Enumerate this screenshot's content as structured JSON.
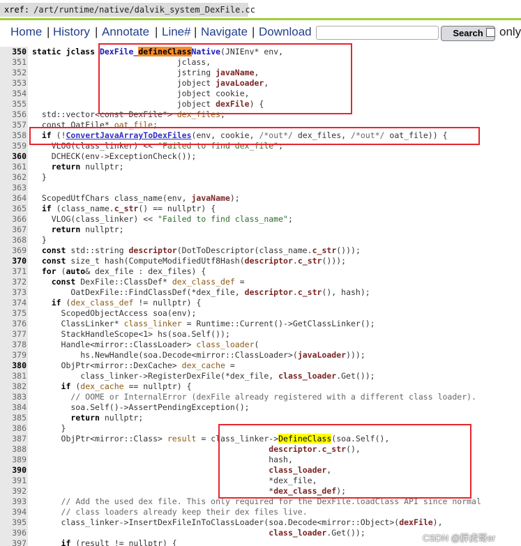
{
  "xref": {
    "label": "xref:",
    "path": "/art/runtime/native/dalvik_system_DexFile.cc"
  },
  "nav": {
    "items": [
      "Home",
      "History",
      "Annotate",
      "Line#",
      "Navigate",
      "Download"
    ],
    "separator": "|",
    "search_button": "Search",
    "only_label": "only"
  },
  "code": [
    {
      "n": "350",
      "b": true,
      "t": [
        [
          "static jclass ",
          "k"
        ],
        [
          "DexFile_",
          "fd"
        ],
        [
          "defineClass",
          "hl"
        ],
        [
          "Native",
          "fd"
        ],
        [
          "(JNIEnv* ",
          ""
        ],
        [
          "env",
          ""
        ],
        [
          ",",
          ""
        ]
      ]
    },
    {
      "n": "351",
      "t": [
        [
          "                              jclass,",
          ""
        ]
      ]
    },
    {
      "n": "352",
      "t": [
        [
          "                              jstring ",
          ""
        ],
        [
          "javaName",
          "v"
        ],
        [
          ",",
          ""
        ]
      ]
    },
    {
      "n": "353",
      "t": [
        [
          "                              jobject ",
          ""
        ],
        [
          "javaLoader",
          "v"
        ],
        [
          ",",
          ""
        ]
      ]
    },
    {
      "n": "354",
      "t": [
        [
          "                              jobject cookie,",
          ""
        ]
      ]
    },
    {
      "n": "355",
      "t": [
        [
          "                              jobject ",
          ""
        ],
        [
          "dexFile",
          "v"
        ],
        [
          ") {",
          ""
        ]
      ]
    },
    {
      "n": "356",
      "t": [
        [
          "  std::vector<const DexFile*> ",
          ""
        ],
        [
          "dex_files",
          "f"
        ],
        [
          ";",
          ""
        ]
      ]
    },
    {
      "n": "357",
      "t": [
        [
          "  const OatFile* ",
          ""
        ],
        [
          "oat_file",
          "f"
        ],
        [
          ";",
          ""
        ]
      ]
    },
    {
      "n": "358",
      "t": [
        [
          "  ",
          ""
        ],
        [
          "if",
          "k"
        ],
        [
          " (!",
          ""
        ],
        [
          "ConvertJavaArrayToDexFiles",
          "fx"
        ],
        [
          "(env, cookie, ",
          ""
        ],
        [
          "/*out*/",
          "c"
        ],
        [
          " dex_files, ",
          ""
        ],
        [
          "/*out*/",
          "c"
        ],
        [
          " oat_file)) {",
          ""
        ]
      ]
    },
    {
      "n": "359",
      "t": [
        [
          "    VLOG(class_linker) << ",
          ""
        ],
        [
          "\"Failed to find dex_file\"",
          "s"
        ],
        [
          ";",
          ""
        ]
      ]
    },
    {
      "n": "360",
      "b": true,
      "t": [
        [
          "    DCHECK(env->ExceptionCheck());",
          ""
        ]
      ]
    },
    {
      "n": "361",
      "t": [
        [
          "    ",
          ""
        ],
        [
          "return",
          "k"
        ],
        [
          " nullptr;",
          ""
        ]
      ]
    },
    {
      "n": "362",
      "t": [
        [
          "  }",
          ""
        ]
      ]
    },
    {
      "n": "363",
      "t": [
        [
          "",
          ""
        ]
      ]
    },
    {
      "n": "364",
      "t": [
        [
          "  ScopedUtfChars class_name(env, ",
          ""
        ],
        [
          "javaName",
          "v"
        ],
        [
          ");",
          ""
        ]
      ]
    },
    {
      "n": "365",
      "t": [
        [
          "  ",
          ""
        ],
        [
          "if",
          "k"
        ],
        [
          " (class_name.",
          ""
        ],
        [
          "c_str",
          "v"
        ],
        [
          "() == nullptr) {",
          ""
        ]
      ]
    },
    {
      "n": "366",
      "t": [
        [
          "    VLOG(class_linker) << ",
          ""
        ],
        [
          "\"Failed to find class_name\"",
          "s"
        ],
        [
          ";",
          ""
        ]
      ]
    },
    {
      "n": "367",
      "t": [
        [
          "    ",
          ""
        ],
        [
          "return",
          "k"
        ],
        [
          " nullptr;",
          ""
        ]
      ]
    },
    {
      "n": "368",
      "t": [
        [
          "  }",
          ""
        ]
      ]
    },
    {
      "n": "369",
      "t": [
        [
          "  ",
          ""
        ],
        [
          "const",
          "k"
        ],
        [
          " std::string ",
          ""
        ],
        [
          "descriptor",
          "v"
        ],
        [
          "(DotToDescriptor(class_name.",
          ""
        ],
        [
          "c_str",
          "v"
        ],
        [
          "()));",
          ""
        ]
      ]
    },
    {
      "n": "370",
      "b": true,
      "t": [
        [
          "  ",
          ""
        ],
        [
          "const",
          "k"
        ],
        [
          " size_t hash(ComputeModifiedUtf8Hash(",
          ""
        ],
        [
          "descriptor",
          "v"
        ],
        [
          ".",
          ""
        ],
        [
          "c_str",
          "v"
        ],
        [
          "()));",
          ""
        ]
      ]
    },
    {
      "n": "371",
      "t": [
        [
          "  ",
          ""
        ],
        [
          "for",
          "k"
        ],
        [
          " (",
          ""
        ],
        [
          "auto",
          "k"
        ],
        [
          "& dex_file : dex_files) {",
          ""
        ]
      ]
    },
    {
      "n": "372",
      "t": [
        [
          "    ",
          ""
        ],
        [
          "const",
          "k"
        ],
        [
          " DexFile::ClassDef* ",
          ""
        ],
        [
          "dex_class_def",
          "f"
        ],
        [
          " =",
          ""
        ]
      ]
    },
    {
      "n": "373",
      "t": [
        [
          "        OatDexFile::FindClassDef(*dex_file, ",
          ""
        ],
        [
          "descriptor",
          "v"
        ],
        [
          ".",
          ""
        ],
        [
          "c_str",
          "v"
        ],
        [
          "(), hash);",
          ""
        ]
      ]
    },
    {
      "n": "374",
      "t": [
        [
          "    ",
          ""
        ],
        [
          "if",
          "k"
        ],
        [
          " (",
          ""
        ],
        [
          "dex_class_def",
          "f"
        ],
        [
          " != nullptr) {",
          ""
        ]
      ]
    },
    {
      "n": "375",
      "t": [
        [
          "      ScopedObjectAccess soa(env);",
          ""
        ]
      ]
    },
    {
      "n": "376",
      "t": [
        [
          "      ClassLinker* ",
          ""
        ],
        [
          "class_linker",
          "f"
        ],
        [
          " = Runtime::Current()->GetClassLinker();",
          ""
        ]
      ]
    },
    {
      "n": "377",
      "t": [
        [
          "      StackHandleScope<1> hs(soa.Self());",
          ""
        ]
      ]
    },
    {
      "n": "378",
      "t": [
        [
          "      Handle<mirror::ClassLoader> ",
          ""
        ],
        [
          "class_loader",
          "f"
        ],
        [
          "(",
          ""
        ]
      ]
    },
    {
      "n": "379",
      "t": [
        [
          "          hs.NewHandle(soa.Decode<mirror::ClassLoader>(",
          ""
        ],
        [
          "javaLoader",
          "v"
        ],
        [
          ")));",
          ""
        ]
      ]
    },
    {
      "n": "380",
      "b": true,
      "t": [
        [
          "      ObjPtr<mirror::DexCache> ",
          ""
        ],
        [
          "dex_cache",
          "f"
        ],
        [
          " =",
          ""
        ]
      ]
    },
    {
      "n": "381",
      "t": [
        [
          "          class_linker->RegisterDexFile(*dex_file, ",
          ""
        ],
        [
          "class_loader",
          "v"
        ],
        [
          ".Get());",
          ""
        ]
      ]
    },
    {
      "n": "382",
      "t": [
        [
          "      ",
          ""
        ],
        [
          "if",
          "k"
        ],
        [
          " (",
          ""
        ],
        [
          "dex_cache",
          "f"
        ],
        [
          " == nullptr) {",
          ""
        ]
      ]
    },
    {
      "n": "383",
      "t": [
        [
          "        ",
          ""
        ],
        [
          "// OOME or InternalError (dexFile already registered with a different class loader).",
          "c"
        ]
      ]
    },
    {
      "n": "384",
      "t": [
        [
          "        soa.Self()->AssertPendingException();",
          ""
        ]
      ]
    },
    {
      "n": "385",
      "t": [
        [
          "        ",
          ""
        ],
        [
          "return",
          "k"
        ],
        [
          " nullptr;",
          ""
        ]
      ]
    },
    {
      "n": "386",
      "t": [
        [
          "      }",
          ""
        ]
      ]
    },
    {
      "n": "387",
      "t": [
        [
          "      ObjPtr<mirror::Class> ",
          ""
        ],
        [
          "result",
          "f"
        ],
        [
          " = class_linker->",
          ""
        ],
        [
          "DefineClass",
          "hy"
        ],
        [
          "(soa.Self(),",
          ""
        ]
      ]
    },
    {
      "n": "388",
      "t": [
        [
          "                                                 ",
          ""
        ],
        [
          "descriptor",
          "v"
        ],
        [
          ".",
          ""
        ],
        [
          "c_str",
          "v"
        ],
        [
          "(),",
          ""
        ]
      ]
    },
    {
      "n": "389",
      "t": [
        [
          "                                                 hash,",
          ""
        ]
      ]
    },
    {
      "n": "390",
      "b": true,
      "t": [
        [
          "                                                 ",
          ""
        ],
        [
          "class_loader",
          "v"
        ],
        [
          ",",
          ""
        ]
      ]
    },
    {
      "n": "391",
      "t": [
        [
          "                                                 *dex_file,",
          ""
        ]
      ]
    },
    {
      "n": "392",
      "t": [
        [
          "                                                 *",
          ""
        ],
        [
          "dex_class_def",
          "v"
        ],
        [
          ");",
          ""
        ]
      ]
    },
    {
      "n": "393",
      "t": [
        [
          "      ",
          ""
        ],
        [
          "// Add the used dex file. This only required for the DexFile.loadClass API since normal",
          "c"
        ]
      ]
    },
    {
      "n": "394",
      "t": [
        [
          "      ",
          ""
        ],
        [
          "// class loaders already keep their dex files live.",
          "c"
        ]
      ]
    },
    {
      "n": "395",
      "t": [
        [
          "      class_linker->InsertDexFileInToClassLoader(soa.Decode<mirror::Object>(",
          ""
        ],
        [
          "dexFile",
          "v"
        ],
        [
          "),",
          ""
        ]
      ]
    },
    {
      "n": "396",
      "t": [
        [
          "                                                 ",
          ""
        ],
        [
          "class_loader",
          "v"
        ],
        [
          ".Get());",
          ""
        ]
      ]
    },
    {
      "n": "397",
      "t": [
        [
          "      ",
          ""
        ],
        [
          "if",
          "k"
        ],
        [
          " (result != nullptr) {",
          ""
        ]
      ]
    }
  ],
  "watermark": "CSDN @胖虎哥er"
}
